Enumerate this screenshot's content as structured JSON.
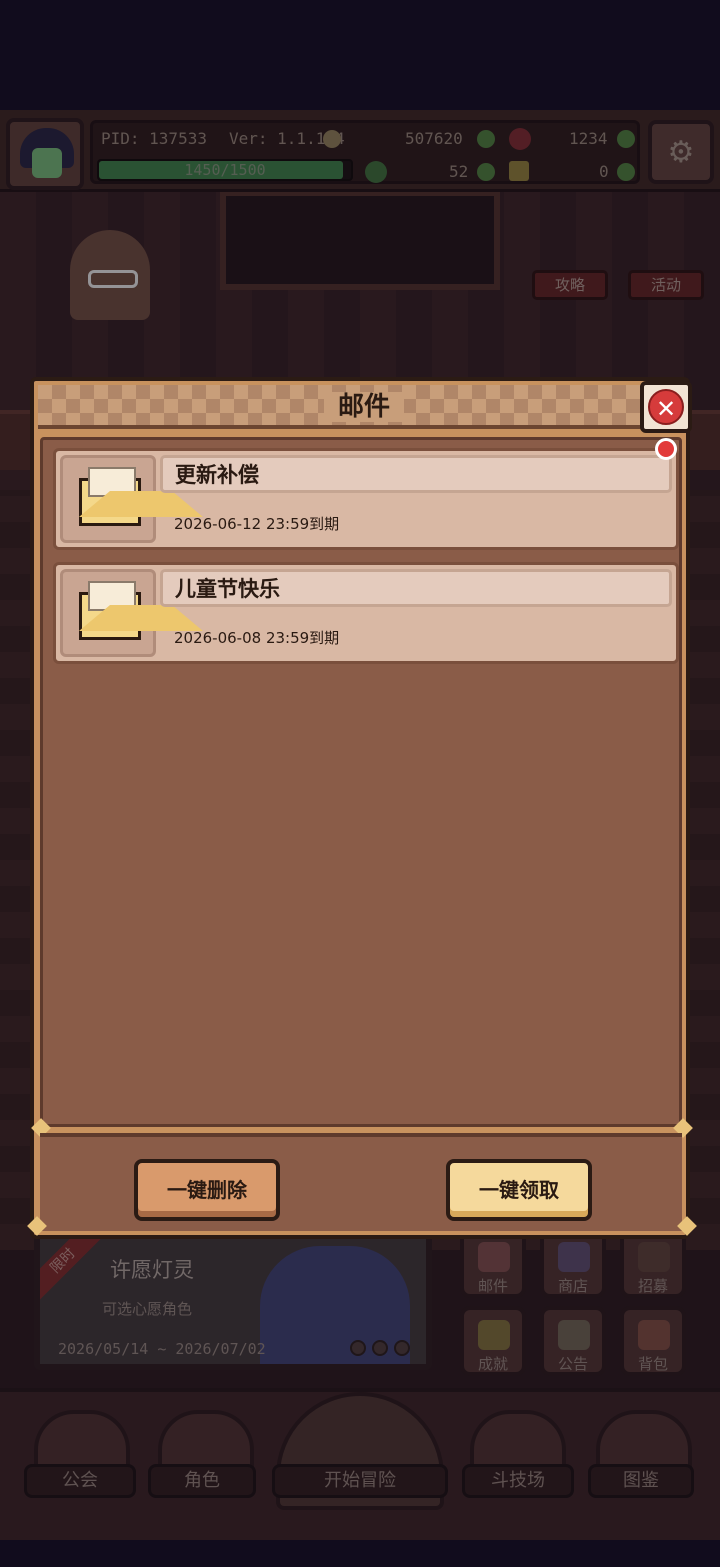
{
  "status": {
    "pid": "PID: 137533",
    "version": "Ver: 1.1.1.4",
    "gold": "507620",
    "gems": "1234",
    "clover": "52",
    "keys": "0",
    "xp": "1450/1500",
    "xp_progress": 0.967
  },
  "side_tags": [
    "攻略",
    "活动"
  ],
  "event_banner": {
    "ribbon": "限时",
    "title": "许愿灯灵",
    "subtitle": "可选心愿角色",
    "date_range": "2026/05/14 ~ 2026/07/02"
  },
  "grid_buttons": [
    "邮件",
    "商店",
    "招募",
    "成就",
    "公告",
    "背包"
  ],
  "bottom_nav": [
    "公会",
    "角色",
    "开始冒险",
    "斗技场",
    "图鉴"
  ],
  "modal": {
    "title": "邮件",
    "close_icon": "close-icon",
    "mails": [
      {
        "title": "更新补偿",
        "expiry": "2026-06-12 23:59到期",
        "unread": true
      },
      {
        "title": "儿童节快乐",
        "expiry": "2026-06-08 23:59到期",
        "unread": false
      }
    ],
    "delete_all_label": "一键删除",
    "claim_all_label": "一键领取"
  },
  "colors": {
    "modal_frame": "#c8925e",
    "mail_card": "#d9b8a4",
    "unread_dot": "#e23a3a",
    "close_button": "#d63b3b"
  }
}
